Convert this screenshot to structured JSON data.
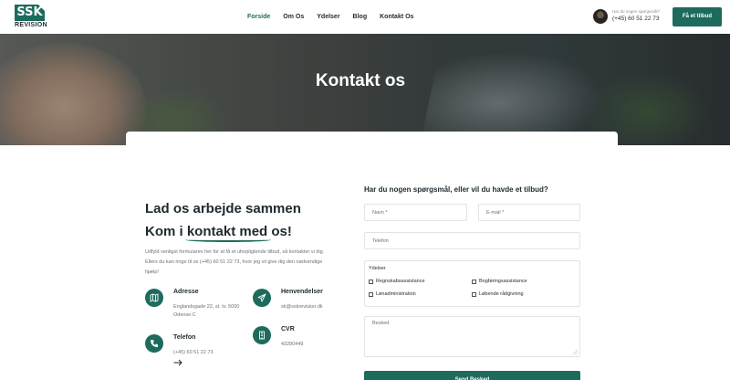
{
  "brand": {
    "logo_top": "SSK",
    "logo_bottom": "REVISION"
  },
  "nav": {
    "items": [
      {
        "label": "Forside",
        "active": true
      },
      {
        "label": "Om Os",
        "active": false
      },
      {
        "label": "Ydelser",
        "active": false
      },
      {
        "label": "Blog",
        "active": false
      },
      {
        "label": "Kontakt Os",
        "active": false
      }
    ]
  },
  "header_contact": {
    "question": "Har du nogen spørgsmål?",
    "phone": "(+45) 60 51 22 73"
  },
  "header_button": "Få et tilbud",
  "hero": {
    "title": "Kontakt os"
  },
  "intro": {
    "heading_line1": "Lad os arbejde sammen",
    "heading_line2_prefix": "Kom i ",
    "heading_line2_highlight": "kontakt med",
    "heading_line2_suffix": " os!",
    "description": "Udfyld venligst formularen her for at få et uforpligtende tilbud, så kontakter vi dig. Ellers du kan ringe til os (+45) 60 51 22 73, hvor jeg vil give dig den nødvendige hjælp!"
  },
  "info": {
    "address": {
      "title": "Adresse",
      "line1": "Englandsgade 22, st. tv. 5000",
      "line2": "Odense C",
      "icon": "map-icon"
    },
    "inquiries": {
      "title": "Henvendelser",
      "value": "sk@sskrevision.dk",
      "icon": "paper-plane-icon"
    },
    "phone": {
      "title": "Telefon",
      "value": "(+45) 60 51 22 73",
      "icon": "phone-icon"
    },
    "cvr": {
      "title": "CVR",
      "value": "43280449",
      "icon": "building-icon"
    }
  },
  "form": {
    "title": "Har du nogen spørgsmål, eller vil du havde et tilbud?",
    "name_placeholder": "Navn *",
    "email_placeholder": "E-mail *",
    "phone_placeholder": "Telefon",
    "services_label": "Ydelser",
    "services": [
      {
        "label": "Regnskabsassistance",
        "checked": false
      },
      {
        "label": "Bogføringsassistance",
        "checked": false
      },
      {
        "label": "Lønadministration",
        "checked": false
      },
      {
        "label": "Løbende rådgivning",
        "checked": false
      }
    ],
    "message_placeholder": "Besked",
    "submit_label": "Send Besked"
  },
  "colors": {
    "accent": "#1d6b5c",
    "text": "#1f2a2e",
    "muted": "#6b7274",
    "border": "#e1e4e5"
  }
}
